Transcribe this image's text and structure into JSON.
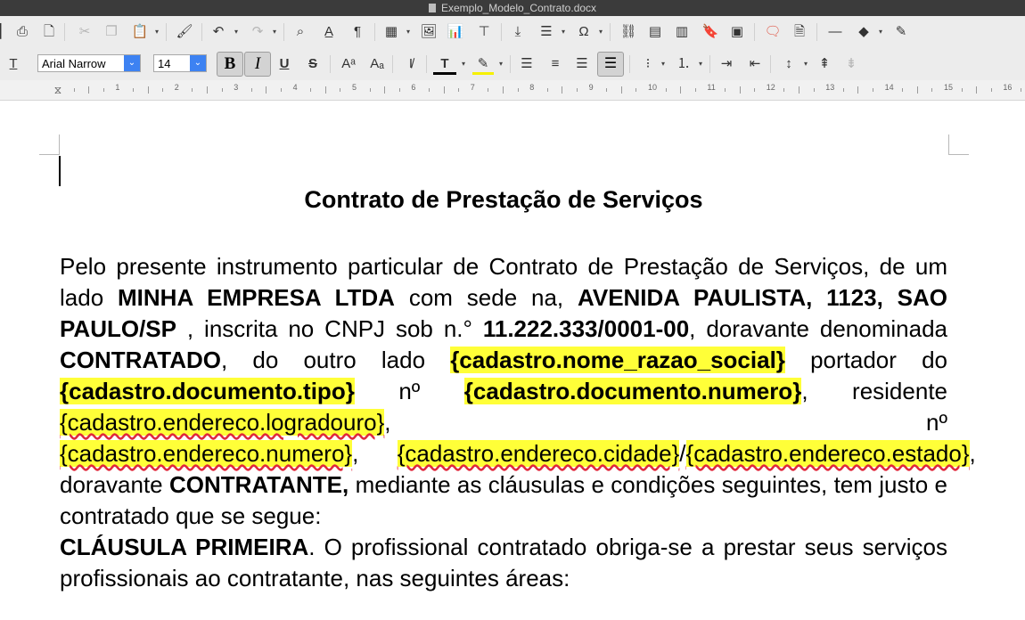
{
  "window": {
    "title": "Exemplo_Modelo_Contrato.docx"
  },
  "toolbar": {
    "font_name": "Arial Narrow",
    "font_size": "14"
  },
  "ruler": {
    "numbers": [
      "1",
      "2",
      "3",
      "4",
      "5",
      "6",
      "7",
      "8",
      "9",
      "10",
      "11",
      "12",
      "13",
      "14",
      "15",
      "16"
    ]
  },
  "document": {
    "title": "Contrato de Prestação de Serviços",
    "p1": {
      "t1": "Pelo presente instrumento particular de Contrato de Prestação de Serviços, de um lado ",
      "b1": "MINHA EMPRESA LTDA",
      "t2": " com sede na, ",
      "b2": "AVENIDA PAULISTA,  1123, SAO PAULO/SP",
      "t3": " , inscrita no CNPJ sob n.° ",
      "b3": "11.222.333/0001-00",
      "t4": ", doravante denominada ",
      "b4": "CONTRATADO",
      "t5": ", do outro lado ",
      "f1": "{cadastro.nome_razao_social}",
      "t6": " portador do ",
      "f2": "{cadastro.documento.tipo}",
      "t7": " nº  ",
      "f3": "{cadastro.documento.numero}",
      "t8": ",  residente  ",
      "f4": "{cadastro.endereco.logradouro}",
      "t9": ",  nº ",
      "f5": "{cadastro.endereco.numero}",
      "t10": ",      ",
      "f6": "{cadastro.endereco.cidade}",
      "t11": "/",
      "f7": "{cadastro.endereco.estado}",
      "t12": ", doravante ",
      "b5": "CONTRATANTE,",
      "t13": " mediante as cláusulas e condições seguintes, tem justo e contratado que se segue:"
    },
    "p2": {
      "b1": "CLÁUSULA PRIMEIRA",
      "t1": ". O profissional contratado obriga-se a prestar seus serviços profissionais ao contratante, nas seguintes áreas:"
    }
  }
}
